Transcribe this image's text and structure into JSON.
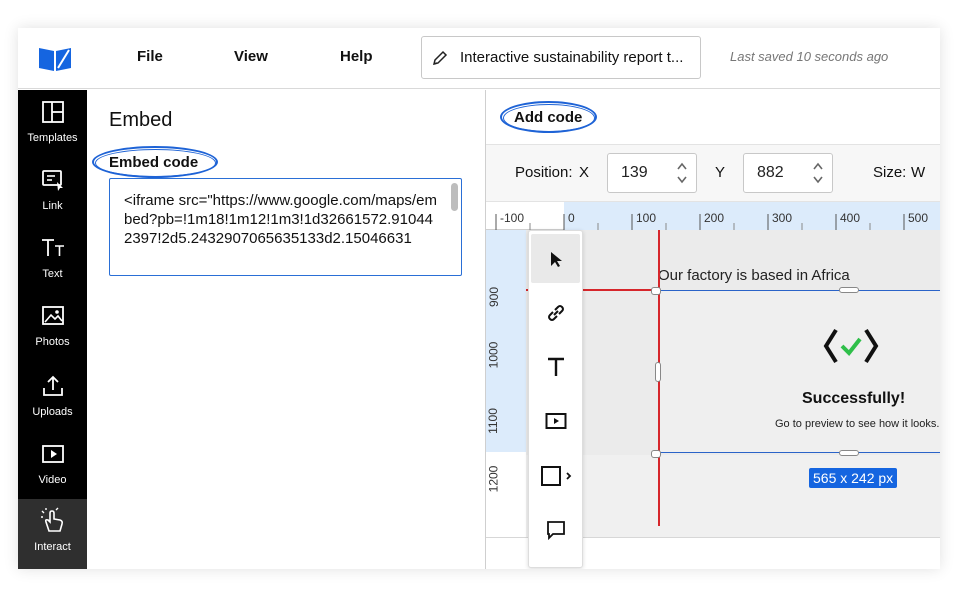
{
  "menu": {
    "file": "File",
    "view": "View",
    "help": "Help"
  },
  "document": {
    "title": "Interactive sustainability report t...",
    "saved_status": "Last saved 10 seconds ago"
  },
  "sidebar": {
    "items": [
      {
        "label": "Templates",
        "icon": "templates-icon"
      },
      {
        "label": "Link",
        "icon": "link-icon"
      },
      {
        "label": "Text",
        "icon": "text-icon"
      },
      {
        "label": "Photos",
        "icon": "photos-icon"
      },
      {
        "label": "Uploads",
        "icon": "uploads-icon"
      },
      {
        "label": "Video",
        "icon": "video-icon"
      },
      {
        "label": "Interact",
        "icon": "interact-icon",
        "active": true
      }
    ]
  },
  "panel": {
    "title": "Embed",
    "embed_label": "Embed code",
    "code": "<iframe src=\"https://www.google.com/maps/embed?pb=!1m18!1m12!1m3!1d32661572.910442397!2d5.2432907065635133d2.15046631"
  },
  "editor": {
    "add_code": "Add code",
    "position_label": "Position:",
    "x_label": "X",
    "x_value": "139",
    "y_label": "Y",
    "y_value": "882",
    "size_label": "Size:",
    "w_label": "W",
    "ruler_h": [
      "-100",
      "0",
      "100",
      "200",
      "300",
      "400",
      "500"
    ],
    "ruler_v": [
      "900",
      "1000",
      "1100",
      "1200"
    ],
    "canvas_heading": "Our factory is based in Africa",
    "success_title": "Successfully!",
    "success_sub": "Go to preview to see how it looks.",
    "dimensions": "565 x 242 px"
  },
  "tools": [
    "select-tool",
    "link-tool",
    "text-tool",
    "media-tool",
    "shape-tool",
    "comment-tool"
  ],
  "colors": {
    "accent": "#1565e0",
    "guide": "#d6262b",
    "success": "#2fbf4a"
  }
}
